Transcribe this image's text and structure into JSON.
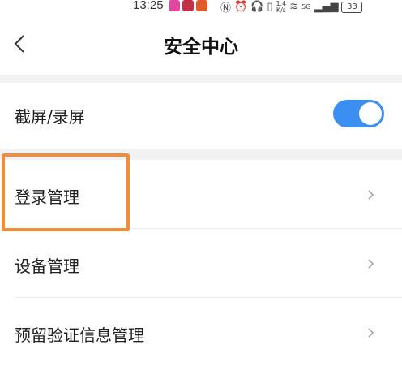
{
  "status_bar": {
    "time": "13:25",
    "speed_value": "1.4",
    "speed_unit": "K/s",
    "network": "5G",
    "battery": "33"
  },
  "header": {
    "title": "安全中心"
  },
  "settings": {
    "screenshot_record": {
      "label": "截屏/录屏",
      "enabled": true
    },
    "items": [
      {
        "label": "登录管理"
      },
      {
        "label": "设备管理"
      },
      {
        "label": "预留验证信息管理"
      }
    ]
  },
  "colors": {
    "accent": "#3a8ff0",
    "highlight": "#ef8f3c",
    "separator": "#f2f2f2"
  }
}
